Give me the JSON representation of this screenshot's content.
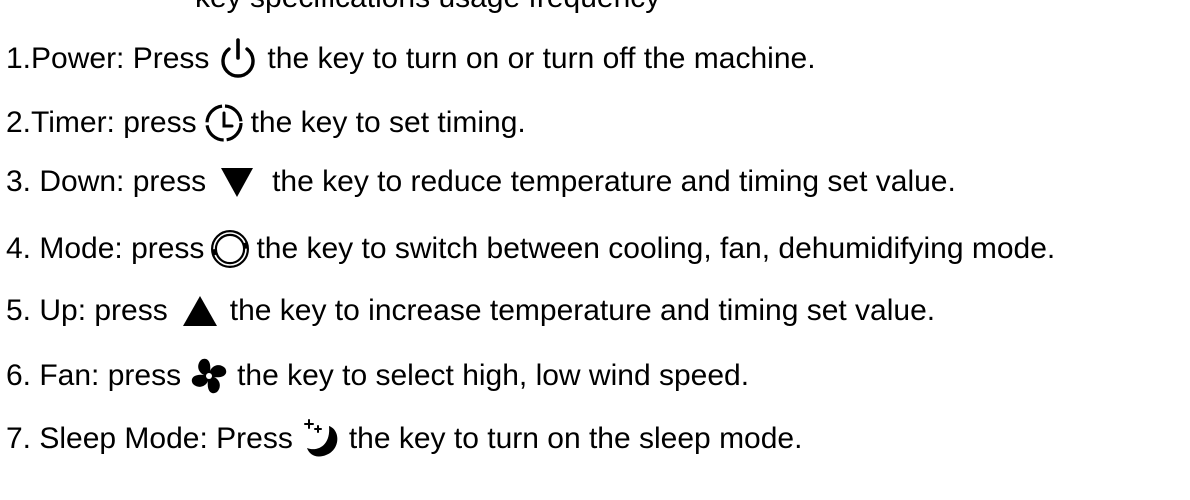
{
  "top_cut_text": "key specifications usage frequency",
  "instructions": [
    {
      "prefix": "1.Power: Press",
      "icon": "power-icon",
      "suffix": "the key to turn on or turn off the machine."
    },
    {
      "prefix": "2.Timer: press",
      "icon": "timer-clock-icon",
      "suffix": "the key to set timing."
    },
    {
      "prefix": "3. Down: press",
      "icon": "down-triangle-icon",
      "suffix": "the key to reduce temperature and timing set value."
    },
    {
      "prefix": "4. Mode: press",
      "icon": "mode-ring-icon",
      "suffix": "the key to switch between cooling, fan, dehumidifying mode."
    },
    {
      "prefix": "5. Up: press",
      "icon": "up-triangle-icon",
      "suffix": "the key to increase temperature and timing set value."
    },
    {
      "prefix": "6. Fan: press",
      "icon": "fan-icon",
      "suffix": "the key to select high, low wind speed."
    },
    {
      "prefix": "7. Sleep Mode: Press",
      "icon": "sleep-moon-icon",
      "suffix": "the key to turn on the sleep mode."
    }
  ]
}
